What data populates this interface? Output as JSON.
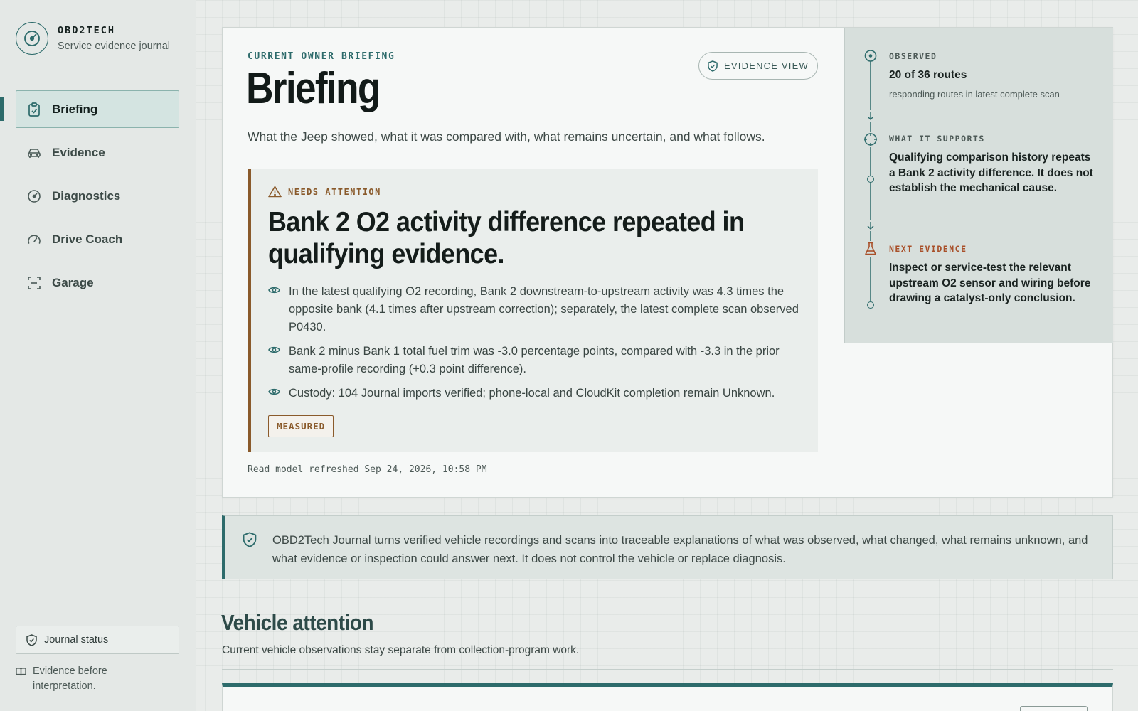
{
  "brand": {
    "name": "OBD2TECH",
    "subtitle": "Service evidence journal"
  },
  "nav": [
    {
      "label": "Briefing",
      "icon": "clipboard-check-icon",
      "active": true
    },
    {
      "label": "Evidence",
      "icon": "car-icon",
      "active": false
    },
    {
      "label": "Diagnostics",
      "icon": "gauge-icon",
      "active": false
    },
    {
      "label": "Drive Coach",
      "icon": "speedometer-icon",
      "active": false
    },
    {
      "label": "Garage",
      "icon": "scan-frame-icon",
      "active": false
    }
  ],
  "sidebar_footer": {
    "journal_status": "Journal status",
    "note": "Evidence before interpretation."
  },
  "briefing": {
    "eyebrow": "CURRENT OWNER BRIEFING",
    "title": "Briefing",
    "evidence_view_label": "EVIDENCE VIEW",
    "lede": "What the Jeep showed, what it was compared with, what remains uncertain, and what follows.",
    "attention": {
      "label": "NEEDS ATTENTION",
      "title": "Bank 2 O2 activity difference repeated in qualifying evidence.",
      "points": [
        "In the latest qualifying O2 recording, Bank 2 downstream-to-upstream activity was 4.3 times the opposite bank (4.1 times after upstream correction); separately, the latest complete scan observed P0430.",
        "Bank 2 minus Bank 1 total fuel trim was -3.0 percentage points, compared with -3.3 in the prior same-profile recording (+0.3 point difference).",
        "Custody: 104 Journal imports verified; phone-local and CloudKit completion remain Unknown."
      ],
      "badge": "MEASURED"
    },
    "refreshed": "Read model refreshed Sep 24, 2026, 10:58 PM"
  },
  "rail": {
    "observed": {
      "label": "OBSERVED",
      "value": "20 of 36 routes",
      "meta": "responding routes in latest complete scan"
    },
    "supports": {
      "label": "WHAT IT SUPPORTS",
      "value": "Qualifying comparison history repeats a Bank 2 activity difference. It does not establish the mechanical cause."
    },
    "next": {
      "label": "NEXT EVIDENCE",
      "value": "Inspect or service-test the relevant upstream O2 sensor and wiring before drawing a catalyst-only conclusion."
    }
  },
  "banner": {
    "text": "OBD2Tech Journal turns verified vehicle recordings and scans into traceable explanations of what was observed, what changed, what remains unknown, and what evidence or inspection could answer next. It does not control the vehicle or replace diagnosis."
  },
  "vehicle_attention": {
    "title": "Vehicle attention",
    "subtitle": "Current vehicle observations stay separate from collection-program work."
  },
  "colors": {
    "accent": "#2d6b6b",
    "warning": "#8a5a2b",
    "next": "#a8502a"
  }
}
